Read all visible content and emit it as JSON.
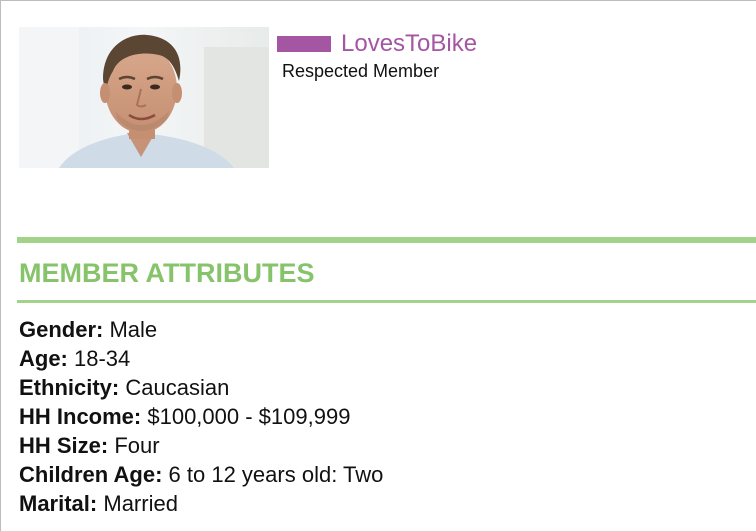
{
  "profile": {
    "username": "LovesToBike",
    "rank": "Respected Member",
    "accent_color": "#a456a3",
    "photo_alt": "member-photo"
  },
  "section": {
    "title": "MEMBER ATTRIBUTES",
    "accent_color": "#86c36b"
  },
  "attributes": [
    {
      "label": "Gender:",
      "value": " Male"
    },
    {
      "label": "Age:",
      "value": " 18-34"
    },
    {
      "label": "Ethnicity:",
      "value": " Caucasian"
    },
    {
      "label": "HH Income:",
      "value": " $100,000 - $109,999"
    },
    {
      "label": "HH Size:",
      "value": " Four"
    },
    {
      "label": "Children Age:",
      "value": " 6 to 12 years old: Two"
    },
    {
      "label": "Marital:",
      "value": " Married"
    }
  ]
}
